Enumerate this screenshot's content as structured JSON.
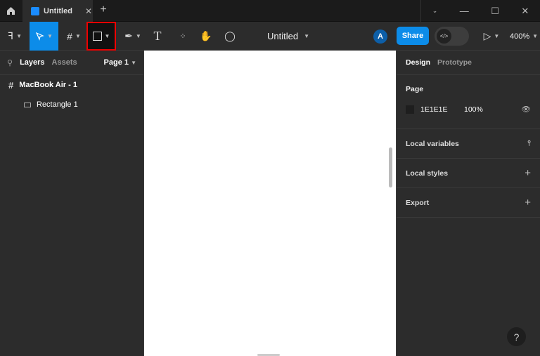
{
  "tab": {
    "title": "Untitled"
  },
  "toolbar": {
    "doc_title": "Untitled",
    "avatar_initial": "A",
    "share_label": "Share",
    "dev_mode_icon": "</>",
    "zoom": "400%"
  },
  "left_panel": {
    "tabs": [
      "Layers",
      "Assets"
    ],
    "page": "Page 1",
    "layers": [
      {
        "name": "MacBook Air - 1",
        "type": "frame"
      },
      {
        "name": "Rectangle 1",
        "type": "rectangle"
      }
    ]
  },
  "right_panel": {
    "tabs": [
      "Design",
      "Prototype"
    ],
    "page_label": "Page",
    "page_color": "1E1E1E",
    "page_color_hex": "#1e1e1e",
    "page_opacity": "100%",
    "sections": [
      "Local variables",
      "Local styles",
      "Export"
    ]
  },
  "help": "?"
}
